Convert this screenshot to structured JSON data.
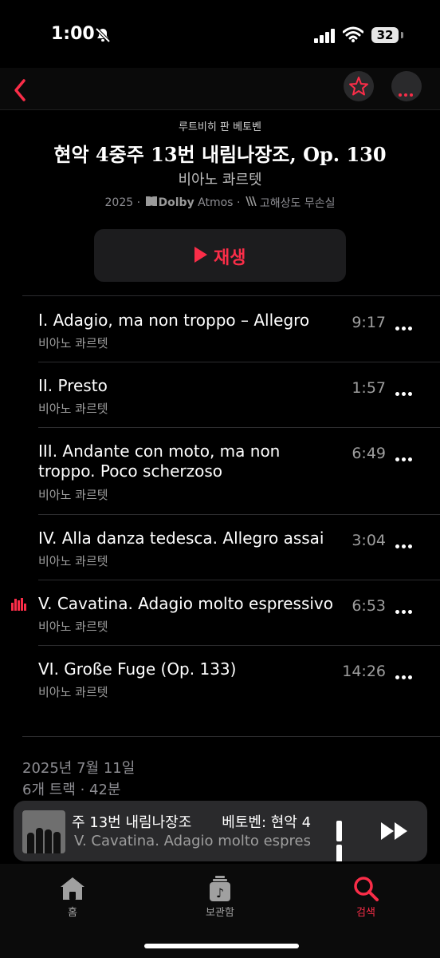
{
  "status_bar": {
    "time": "1:00",
    "battery": "32",
    "icons": [
      "bell-slash-icon",
      "signal-bars-icon",
      "wifi-icon",
      "battery-icon"
    ]
  },
  "nav": {
    "back_icon": "chevron-left-icon",
    "favorite_icon": "star-icon",
    "more_icon": "ellipsis-icon"
  },
  "album": {
    "composer": "루트비히 판 베토벤",
    "title": "현악 4중주 13번 내림나장조, Op. 130",
    "artist": "비아노 콰르텟",
    "year": "2025",
    "dolby": "Dolby",
    "atmos": "Atmos",
    "lossless": "고해상도 무손실",
    "play_label": "재생"
  },
  "tracks": [
    {
      "title": "I. Adagio, ma non troppo – Allegro",
      "artist": "비아노 콰르텟",
      "duration": "9:17"
    },
    {
      "title": "II. Presto",
      "artist": "비아노 콰르텟",
      "duration": "1:57"
    },
    {
      "title": "III. Andante con moto, ma non troppo. Poco scherzoso",
      "artist": "비아노 콰르텟",
      "duration": "6:49"
    },
    {
      "title": "IV. Alla danza tedesca. Allegro assai",
      "artist": "비아노 콰르텟",
      "duration": "3:04"
    },
    {
      "title": "V. Cavatina. Adagio molto espressivo",
      "artist": "비아노 콰르텟",
      "duration": "6:53",
      "now_playing": true
    },
    {
      "title": "VI. Große Fuge (Op. 133)",
      "artist": "비아노 콰르텟",
      "duration": "14:26"
    }
  ],
  "footer": {
    "release_date": "2025년 7월 11일",
    "track_count": "6개 트랙 · 42분"
  },
  "mini_player": {
    "title_part": "주 13번 내림나장조",
    "album_part": "베토벤: 현악 4",
    "subtitle": "V. Cavatina. Adagio molto espres"
  },
  "tabs": [
    {
      "label": "홈",
      "icon": "home-icon"
    },
    {
      "label": "보관함",
      "icon": "library-icon"
    },
    {
      "label": "검색",
      "icon": "search-icon",
      "active": true
    }
  ],
  "colors": {
    "accent": "#fa2d48",
    "background": "#000000",
    "secondary_text": "#9e9e9e"
  }
}
